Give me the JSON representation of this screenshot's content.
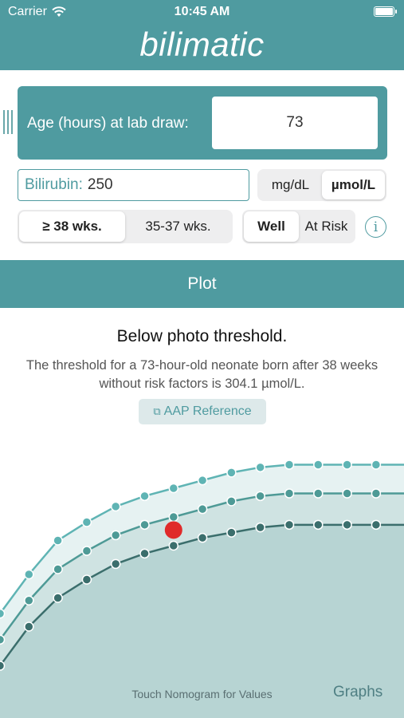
{
  "status_bar": {
    "carrier": "Carrier",
    "time": "10:45 AM"
  },
  "app": {
    "title": "bilimatic"
  },
  "age": {
    "label": "Age (hours) at lab draw:",
    "value": "73"
  },
  "bilirubin": {
    "label": "Bilirubin:",
    "value": "250"
  },
  "units": {
    "options": [
      "mg/dL",
      "µmol/L"
    ],
    "selected": "µmol/L"
  },
  "gestation": {
    "options": [
      "≥ 38 wks.",
      "35-37 wks."
    ],
    "selected": "≥ 38 wks."
  },
  "risk": {
    "options": [
      "Well",
      "At Risk"
    ],
    "selected": "Well"
  },
  "plot_button": "Plot",
  "result": {
    "title": "Below photo threshold.",
    "description": "The threshold for a 73-hour-old neonate born after 38 weeks without risk factors is 304.1 µmol/L."
  },
  "aap_reference": "AAP Reference",
  "footer": {
    "hint": "Touch Nomogram for Values",
    "graphs_link": "Graphs"
  },
  "colors": {
    "accent": "#4f9ba0",
    "top_curve": "#5fb4b4",
    "middle_curve": "#4e9a96",
    "bottom_curve": "#3b6e6c",
    "patient_point": "#e02a2a"
  },
  "chart_data": {
    "type": "line",
    "series": [
      {
        "values": [
          40,
          55,
          68,
          75,
          81,
          85,
          88,
          91,
          94,
          96,
          97,
          97,
          97,
          97
        ]
      },
      {
        "values": [
          30,
          45,
          57,
          64,
          70,
          74,
          77,
          80,
          83,
          85,
          86,
          86,
          86,
          86
        ]
      },
      {
        "values": [
          20,
          35,
          46,
          53,
          59,
          63,
          66,
          69,
          71,
          73,
          74,
          74,
          74,
          74
        ]
      }
    ],
    "patient_point": {
      "series_index": 1,
      "point_index": 6,
      "y": 72
    },
    "ylim": [
      0,
      110
    ]
  }
}
